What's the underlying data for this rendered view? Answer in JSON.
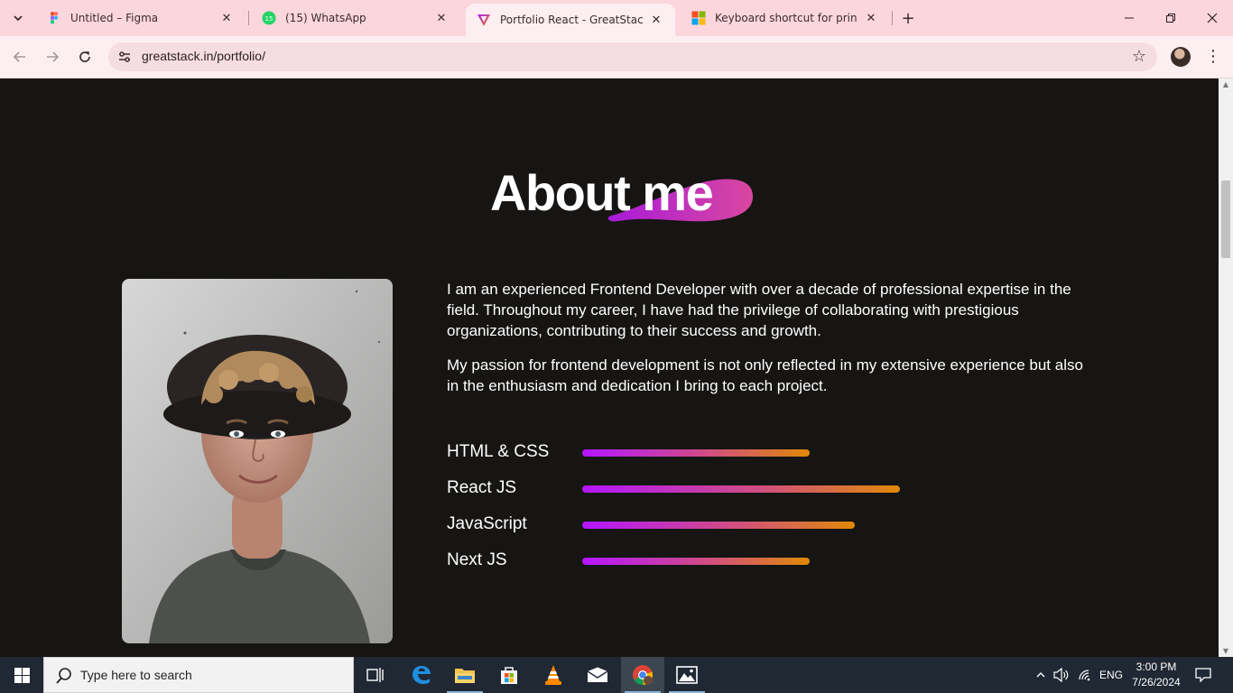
{
  "browser": {
    "tabs": [
      {
        "title": "Untitled – Figma",
        "icon": "figma-icon",
        "active": false
      },
      {
        "title": "(15) WhatsApp",
        "icon": "whatsapp-icon",
        "badge": "15",
        "active": false
      },
      {
        "title": "Portfolio React - GreatStack",
        "icon": "greatstack-icon",
        "active": true
      },
      {
        "title": "Keyboard shortcut for print scre",
        "icon": "microsoft-icon",
        "active": false
      }
    ],
    "url": "greatstack.in/portfolio/"
  },
  "page": {
    "heading": "About me",
    "paragraphs": [
      "I am an experienced Frontend Developer with over a decade of professional expertise in the field. Throughout my career, I have had the privilege of collaborating with prestigious organizations, contributing to their success and growth.",
      "My passion for frontend development is not only reflected in my extensive experience but also in the enthusiasm and dedication I bring to each project."
    ],
    "skills": [
      {
        "name": "HTML & CSS",
        "level": 0.5
      },
      {
        "name": "React JS",
        "level": 0.7
      },
      {
        "name": "JavaScript",
        "level": 0.6
      },
      {
        "name": "Next JS",
        "level": 0.5
      }
    ],
    "colors": {
      "background": "#161513",
      "gradient_start": "#b415ff",
      "gradient_end": "#df8908"
    }
  },
  "taskbar": {
    "search_placeholder": "Type here to search",
    "language": "ENG",
    "time": "3:00 PM",
    "date": "7/26/2024"
  }
}
